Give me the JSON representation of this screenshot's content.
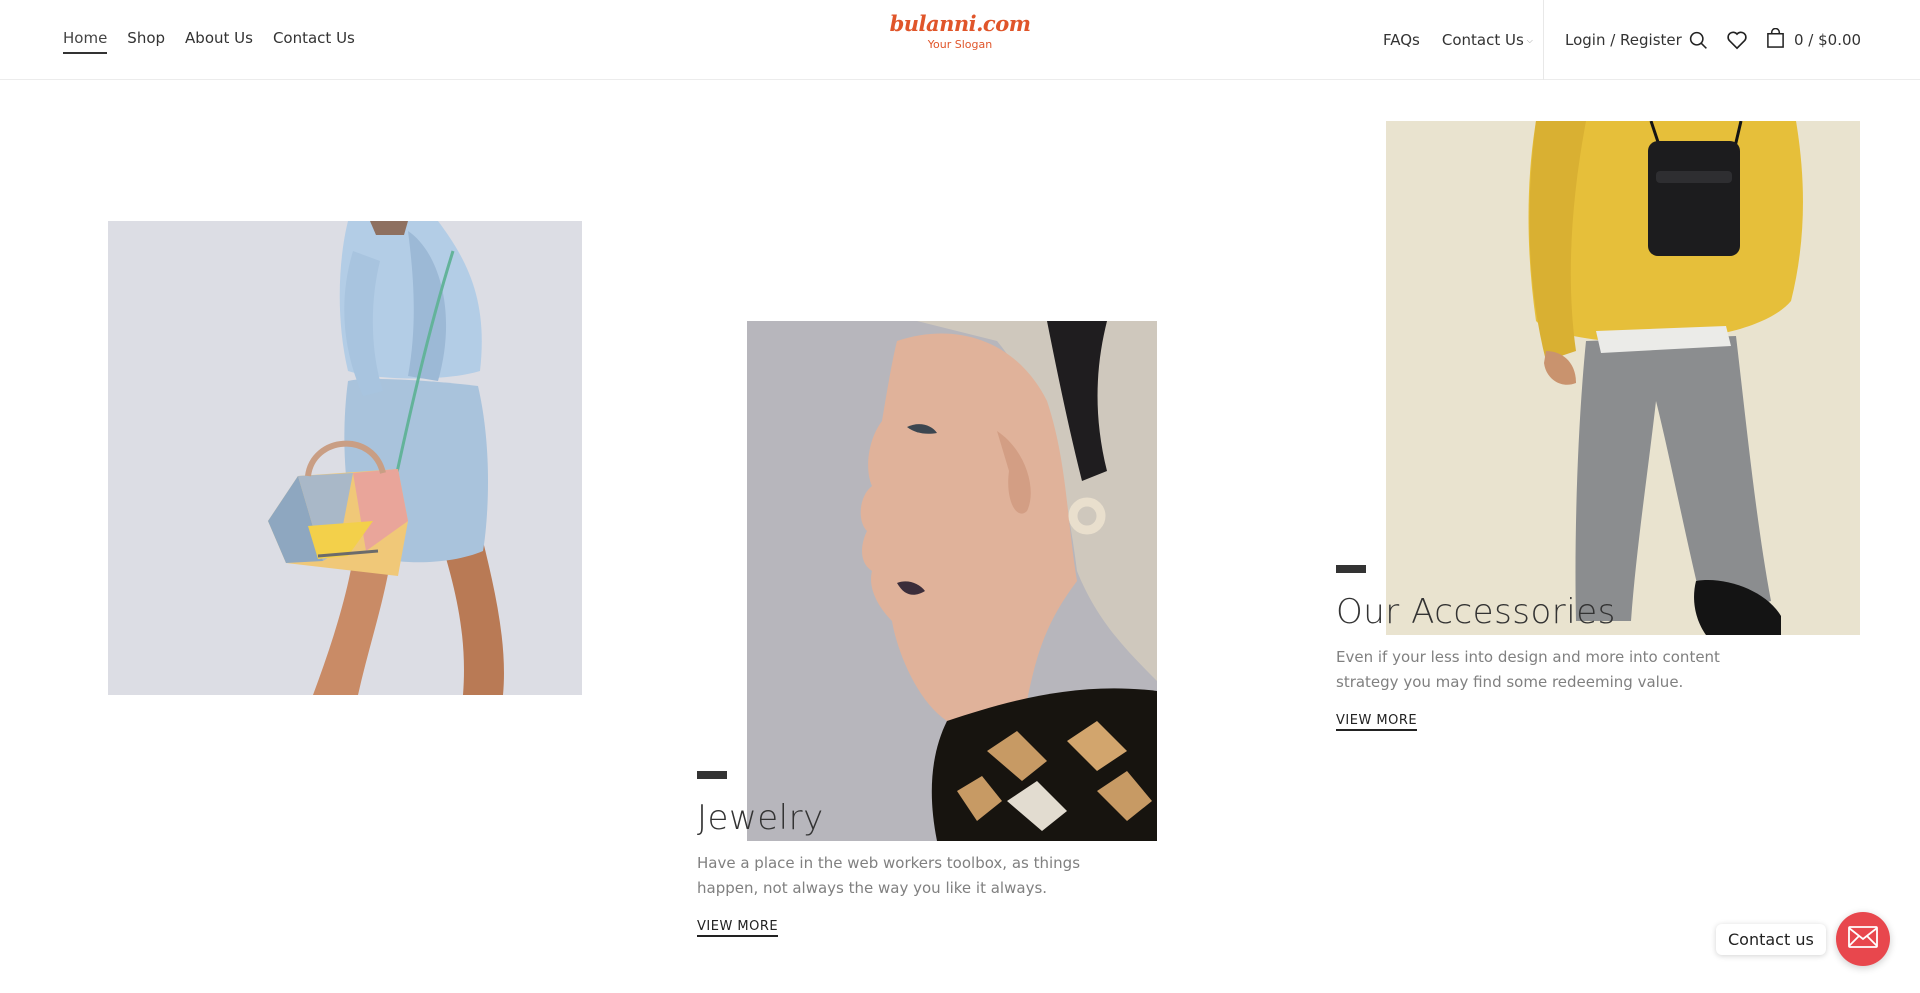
{
  "brand": {
    "name": "bulanni.com",
    "slogan": "Your Slogan",
    "color": "#e0552a"
  },
  "nav": {
    "left": [
      {
        "label": "Home",
        "active": true
      },
      {
        "label": "Shop",
        "active": false
      },
      {
        "label": "About Us",
        "active": false
      },
      {
        "label": "Contact Us",
        "active": false
      }
    ],
    "right": [
      {
        "label": "FAQs"
      },
      {
        "label": "Contact Us"
      }
    ],
    "account_label": "Login / Register",
    "cart_label": "0 / $0.00",
    "icons": [
      "search-icon",
      "heart-icon",
      "shopping-bag-icon",
      "chevron-down-icon"
    ]
  },
  "sections": {
    "jewelry": {
      "title": "Jewelry",
      "description": "Have a place in the web workers toolbox, as things happen, not always the way you like it always.",
      "link": "VIEW MORE"
    },
    "accessories": {
      "title": "Our Accessories",
      "description": "Even if your less into design and more into content strategy you may find some redeeming value.",
      "link": "VIEW MORE"
    }
  },
  "contact_widget": {
    "label": "Contact us",
    "icon": "envelope-icon",
    "color": "#e8474d"
  }
}
